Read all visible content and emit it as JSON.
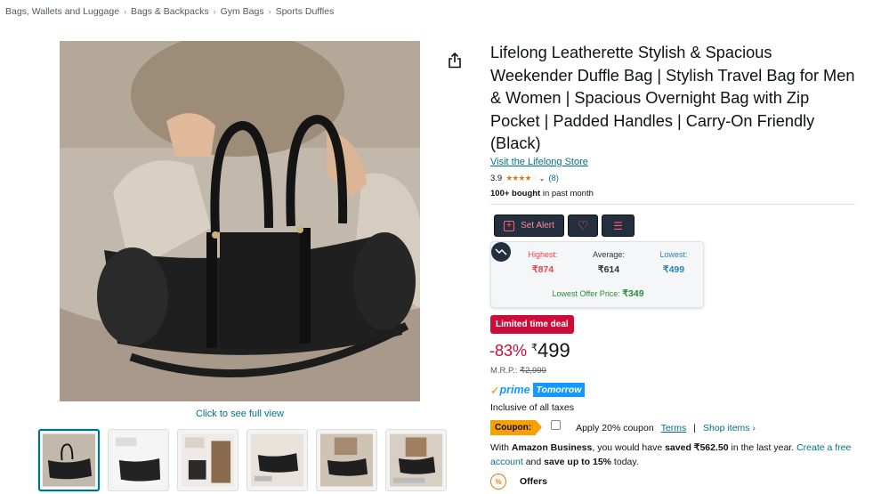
{
  "breadcrumb": [
    "Bags, Wallets and Luggage",
    "Bags & Backpacks",
    "Gym Bags",
    "Sports Duffles"
  ],
  "gallery": {
    "full_view_label": "Click to see full view",
    "thumb_count": 6
  },
  "product": {
    "title": "Lifelong Leatherette Stylish & Spacious Weekender Duffle Bag | Stylish Travel Bag for Men & Women | Spacious Overnight Bag with Zip Pocket | Padded Handles | Carry-On Friendly (Black)",
    "store_link": "Visit the Lifelong Store",
    "rating_value": "3.9",
    "rating_stars": 3.9,
    "rating_count": "(8)",
    "bought_bold": "100+ bought",
    "bought_rest": " in past month"
  },
  "tracker": {
    "set_alert_label": "Set Alert",
    "highest_label": "Highest:",
    "highest_value": "₹874",
    "average_label": "Average:",
    "average_value": "₹614",
    "lowest_label": "Lowest:",
    "lowest_value": "₹499",
    "lowest_offer_label": "Lowest Offer Price:",
    "lowest_offer_value": "₹349"
  },
  "pricing": {
    "deal_badge": "Limited time deal",
    "discount": "-83%",
    "currency": "₹",
    "price": "499",
    "mrp_label": "M.R.P.:",
    "mrp_value": "₹2,999",
    "prime_word": "prime",
    "prime_day": "Tomorrow",
    "taxes": "Inclusive of all taxes"
  },
  "coupon": {
    "tag": "Coupon:",
    "apply": "Apply 20% coupon",
    "terms": "Terms",
    "pipe": "|",
    "shop": "Shop items ›"
  },
  "business": {
    "prefix": "With ",
    "brand": "Amazon Business",
    "mid": ", you would have ",
    "saved": "saved ₹562.50",
    "mid2": " in the last year. ",
    "link": "Create a free account",
    "mid3": " and ",
    "save_upto": "save up to 15%",
    "suffix": " today."
  },
  "offers": {
    "label": "Offers"
  },
  "colors": {
    "link": "#007185",
    "deal_red": "#cc0c39",
    "star": "#de7921",
    "prime_blue": "#1399ff",
    "coupon_orange": "#f7a000",
    "button_dark": "#232f3e"
  }
}
